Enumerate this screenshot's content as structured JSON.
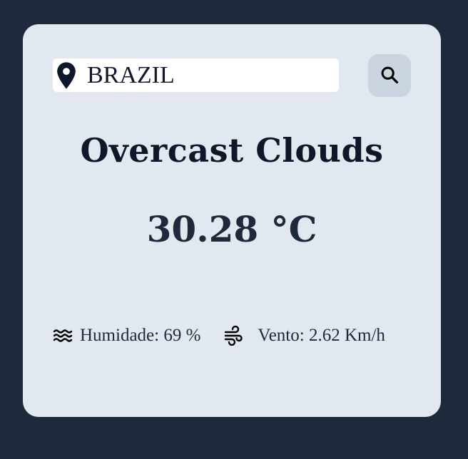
{
  "search": {
    "value": "BRAZIL",
    "placeholder": "",
    "pin_icon": "map-pin-icon",
    "button_icon": "search-icon"
  },
  "weather": {
    "condition": "Overcast Clouds",
    "temperature": "30.28 °C"
  },
  "details": {
    "humidity": {
      "icon": "water-waves-icon",
      "text": "Humidade: 69 %"
    },
    "wind": {
      "icon": "wind-icon",
      "text": "Vento: 2.62 Km/h"
    }
  },
  "colors": {
    "background": "#1e293b",
    "card": "#e2e8f0",
    "search_button": "#cbd5e1",
    "text": "#0f172a"
  }
}
